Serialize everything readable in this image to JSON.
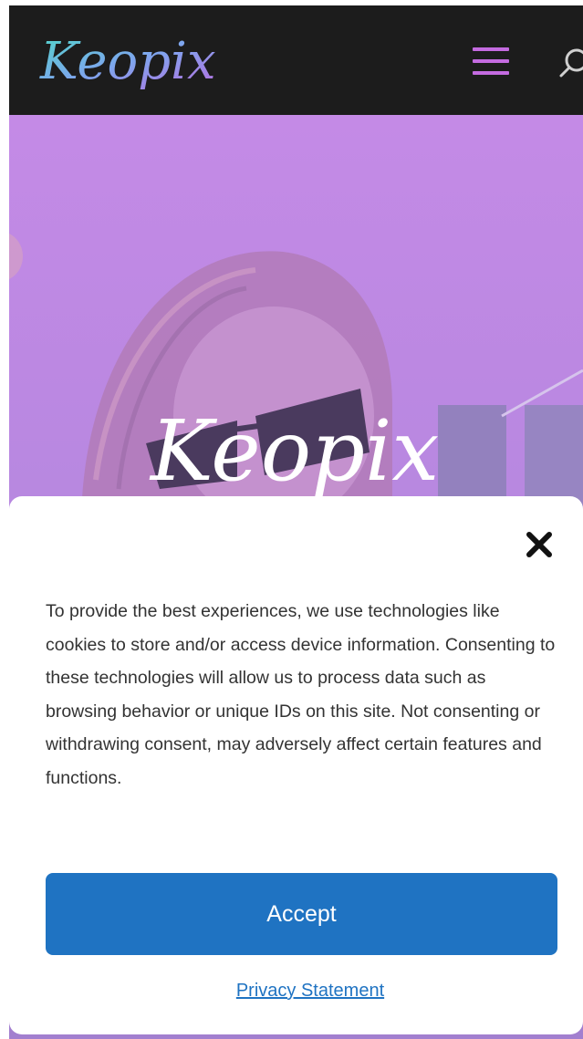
{
  "header": {
    "logo_text": "Keopix",
    "menu_icon": "hamburger-menu-icon",
    "search_icon": "search-icon",
    "background": "#1c1c1c",
    "accent": "#c46be0"
  },
  "hero": {
    "logo_text": "Keopix",
    "overlay_color": "#c184e6"
  },
  "cookie_banner": {
    "close_icon": "close-icon",
    "message": "To provide the best experiences, we use technologies like cookies to store and/or access device information. Consenting to these technologies will allow us to process data such as browsing behavior or unique IDs on this site. Not consenting or withdrawing consent, may adversely affect certain features and functions.",
    "accept_label": "Accept",
    "privacy_label": "Privacy Statement",
    "button_color": "#1f73c2"
  }
}
